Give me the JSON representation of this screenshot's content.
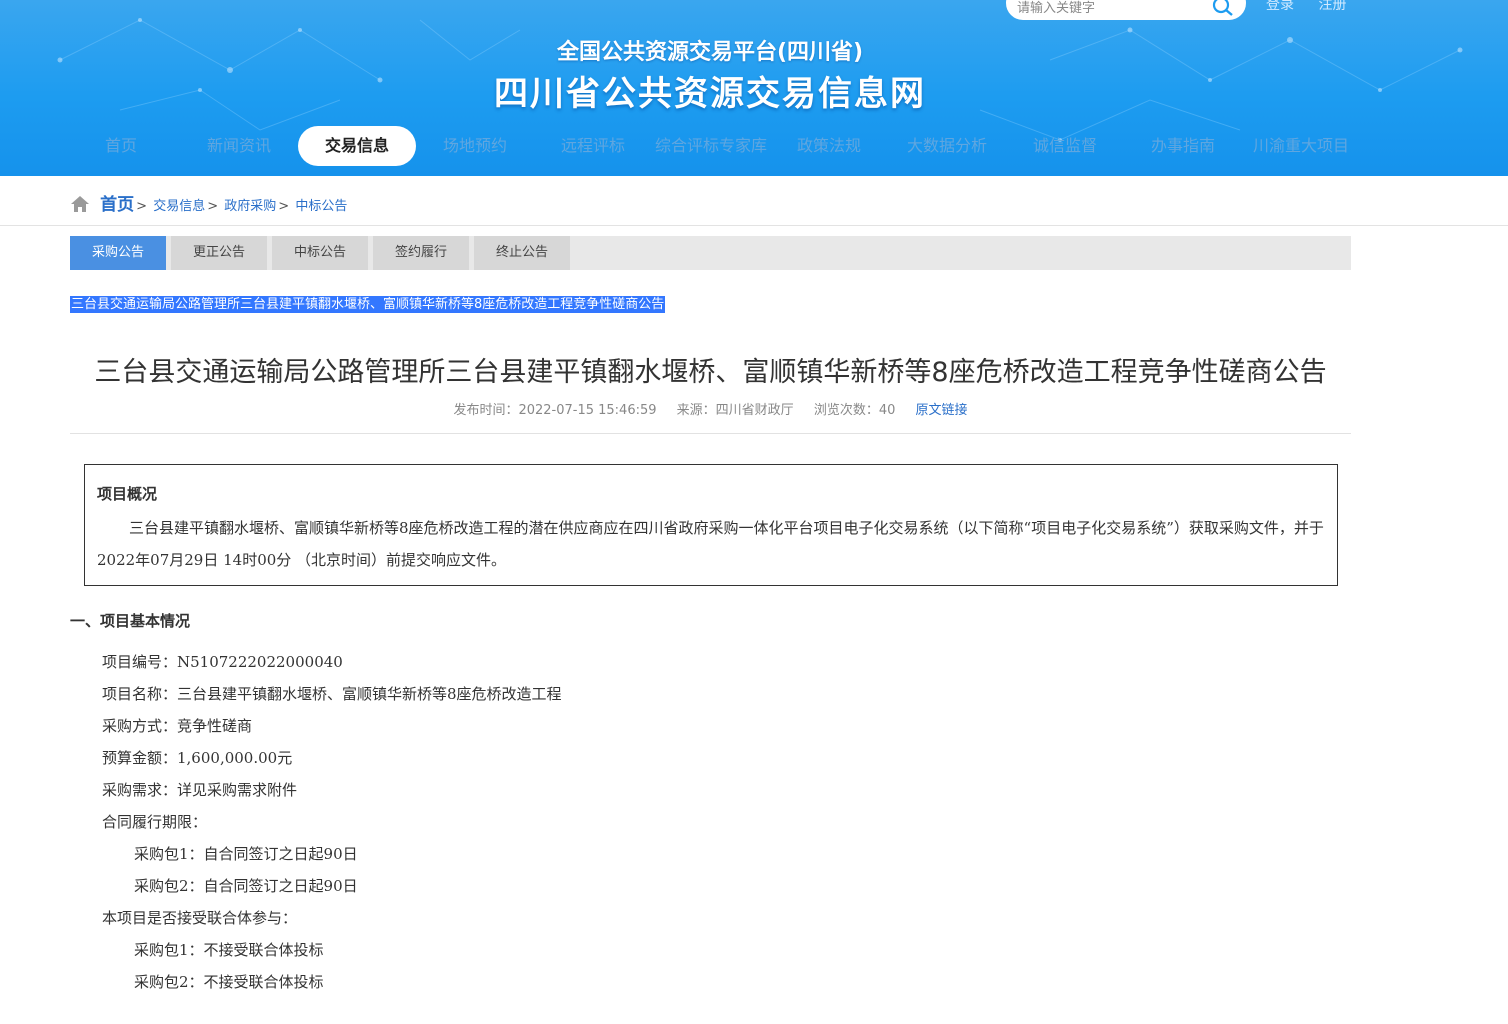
{
  "header": {
    "search_placeholder": "请输入关键字",
    "login": "登录",
    "register": "注册",
    "site_subtitle": "全国公共资源交易平台(四川省)",
    "site_title": "四川省公共资源交易信息网",
    "nav": [
      {
        "label": "首页"
      },
      {
        "label": "新闻资讯"
      },
      {
        "label": "交易信息"
      },
      {
        "label": "场地预约"
      },
      {
        "label": "远程评标"
      },
      {
        "label": "综合评标专家库"
      },
      {
        "label": "政策法规"
      },
      {
        "label": "大数据分析"
      },
      {
        "label": "诚信监督"
      },
      {
        "label": "办事指南"
      },
      {
        "label": "川渝重大项目"
      }
    ]
  },
  "breadcrumb": {
    "home": "首页",
    "items": [
      "交易信息",
      "政府采购",
      "中标公告"
    ],
    "sep": ">"
  },
  "tabs": [
    {
      "label": "采购公告"
    },
    {
      "label": "更正公告"
    },
    {
      "label": "中标公告"
    },
    {
      "label": "签约履行"
    },
    {
      "label": "终止公告"
    }
  ],
  "selected_title": "三台县交通运输局公路管理所三台县建平镇翻水堰桥、富顺镇华新桥等8座危桥改造工程竞争性磋商公告",
  "article": {
    "title": "三台县交通运输局公路管理所三台县建平镇翻水堰桥、富顺镇华新桥等8座危桥改造工程竞争性磋商公告",
    "publish_time": "发布时间：2022-07-15 15:46:59",
    "source": "来源：四川省财政厅",
    "views": "浏览次数：40",
    "original_link": "原文链接"
  },
  "overview": {
    "title": "项目概况",
    "text": "三台县建平镇翻水堰桥、富顺镇华新桥等8座危桥改造工程的潜在供应商应在四川省政府采购一体化平台项目电子化交易系统（以下简称“项目电子化交易系统”）获取采购文件，并于 2022年07月29日 14时00分 （北京时间）前提交响应文件。"
  },
  "section1": {
    "heading": "一、项目基本情况",
    "lines": [
      "项目编号：N5107222022000040",
      "项目名称：三台县建平镇翻水堰桥、富顺镇华新桥等8座危桥改造工程",
      "采购方式：竞争性磋商",
      "预算金额：1,600,000.00元",
      "采购需求：详见采购需求附件",
      "合同履行期限：",
      "采购包1：自合同签订之日起90日",
      "采购包2：自合同签订之日起90日",
      "本项目是否接受联合体参与：",
      "采购包1：不接受联合体投标",
      "采购包2：不接受联合体投标"
    ]
  }
}
